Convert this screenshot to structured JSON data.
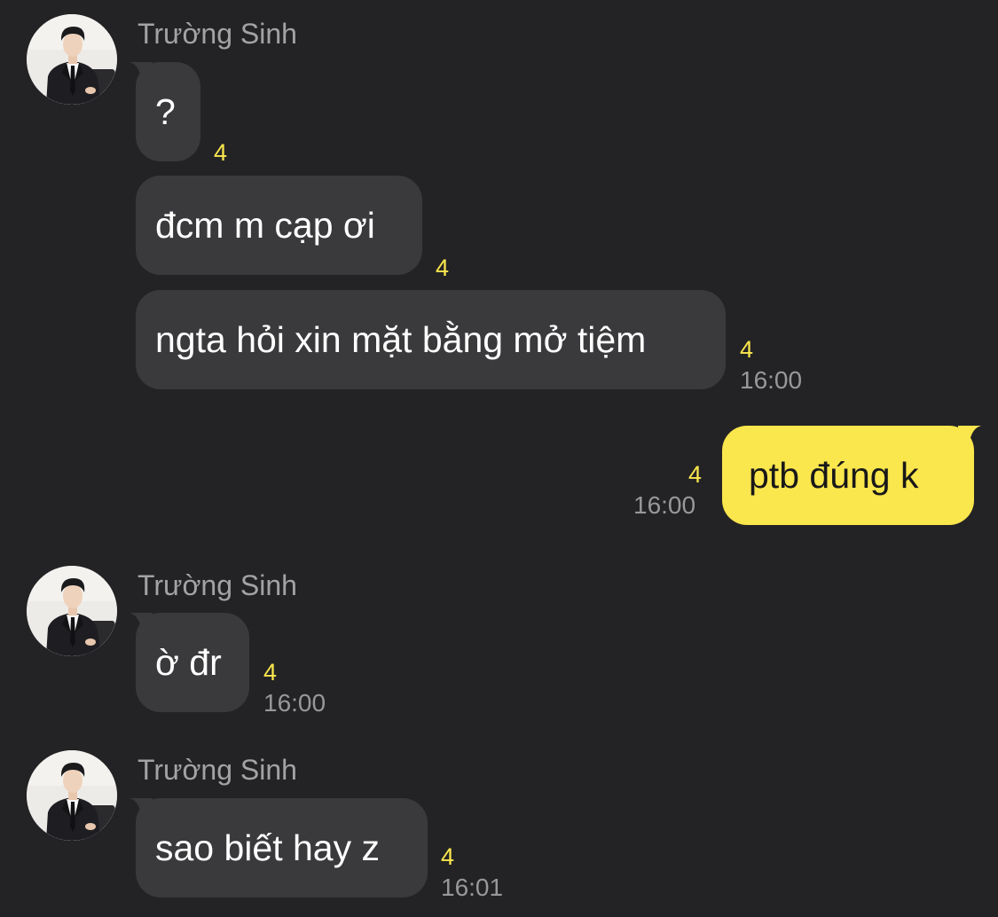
{
  "colors": {
    "background": "#232325",
    "incoming_bubble": "#3a3a3c",
    "outgoing_bubble": "#fae64d",
    "unread_count": "#fae64d",
    "meta_text": "#98989b"
  },
  "groups": [
    {
      "sender": "Trường Sinh",
      "avatar": "person-in-suit-avatar",
      "messages": [
        {
          "text": "?",
          "unread": "4",
          "time": ""
        },
        {
          "text": "đcm m cạp ơi",
          "unread": "4",
          "time": ""
        },
        {
          "text": "ngta hỏi xin mặt bằng mở tiệm",
          "unread": "4",
          "time": "16:00"
        }
      ]
    },
    {
      "sender": "",
      "outgoing": true,
      "messages": [
        {
          "text": "ptb đúng k",
          "unread": "4",
          "time": "16:00"
        }
      ]
    },
    {
      "sender": "Trường Sinh",
      "avatar": "person-in-suit-avatar",
      "messages": [
        {
          "text": "ờ đr",
          "unread": "4",
          "time": "16:00"
        }
      ]
    },
    {
      "sender": "Trường Sinh",
      "avatar": "person-in-suit-avatar",
      "messages": [
        {
          "text": "sao biết hay z",
          "unread": "4",
          "time": "16:01"
        }
      ]
    }
  ]
}
